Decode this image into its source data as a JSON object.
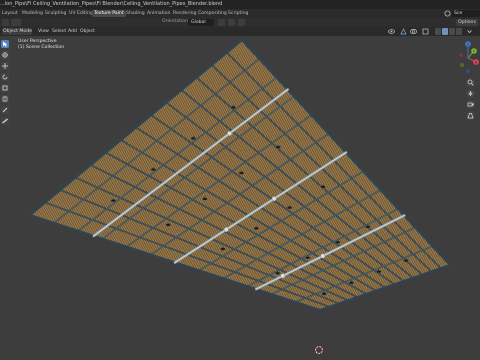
{
  "window": {
    "title": "...lon_Pipe\\Fl Ceiling_Ventilation_Pipes\\Fl Blender\\Ceiling_Ventilation_Pipes_Blender.blend"
  },
  "workspaces": [
    {
      "label": "Layout",
      "active": false
    },
    {
      "label": "Modeling",
      "active": false
    },
    {
      "label": "Sculpting",
      "active": false
    },
    {
      "label": "UV Editing",
      "active": false
    },
    {
      "label": "Texture Paint",
      "active": true
    },
    {
      "label": "Shading",
      "active": false
    },
    {
      "label": "Animation",
      "active": false
    },
    {
      "label": "Rendering",
      "active": false
    },
    {
      "label": "Compositing",
      "active": false
    },
    {
      "label": "Scripting",
      "active": false
    }
  ],
  "scene": {
    "label": "Sce"
  },
  "header": {
    "orientation_label": "Orientation:",
    "orientation_value": "Global",
    "options_label": "Options"
  },
  "viewport_header": {
    "mode": "Object Mode",
    "menus": [
      "View",
      "Select",
      "Add",
      "Object"
    ]
  },
  "viewport_overlay": {
    "view_name": "User Perspective",
    "collection": "(1) Scene Collection"
  },
  "gizmo": {
    "axis_x": "X",
    "axis_y": "Y",
    "axis_z": "Z",
    "colors": {
      "x": "#e0465a",
      "y": "#7cb932",
      "z": "#3e7fd8"
    }
  },
  "colors": {
    "accent": "#5680c2",
    "ceiling_slats": "#7a5f3a",
    "pipe": "#3d5766",
    "background": "#3d3d3d"
  },
  "icons": {
    "toolbar": [
      "select-box-icon",
      "cursor-icon",
      "move-icon",
      "rotate-icon",
      "scale-icon",
      "transform-icon",
      "annotate-icon",
      "measure-icon"
    ],
    "nav": [
      "zoom-icon",
      "pan-icon",
      "camera-icon",
      "perspective-icon"
    ]
  }
}
